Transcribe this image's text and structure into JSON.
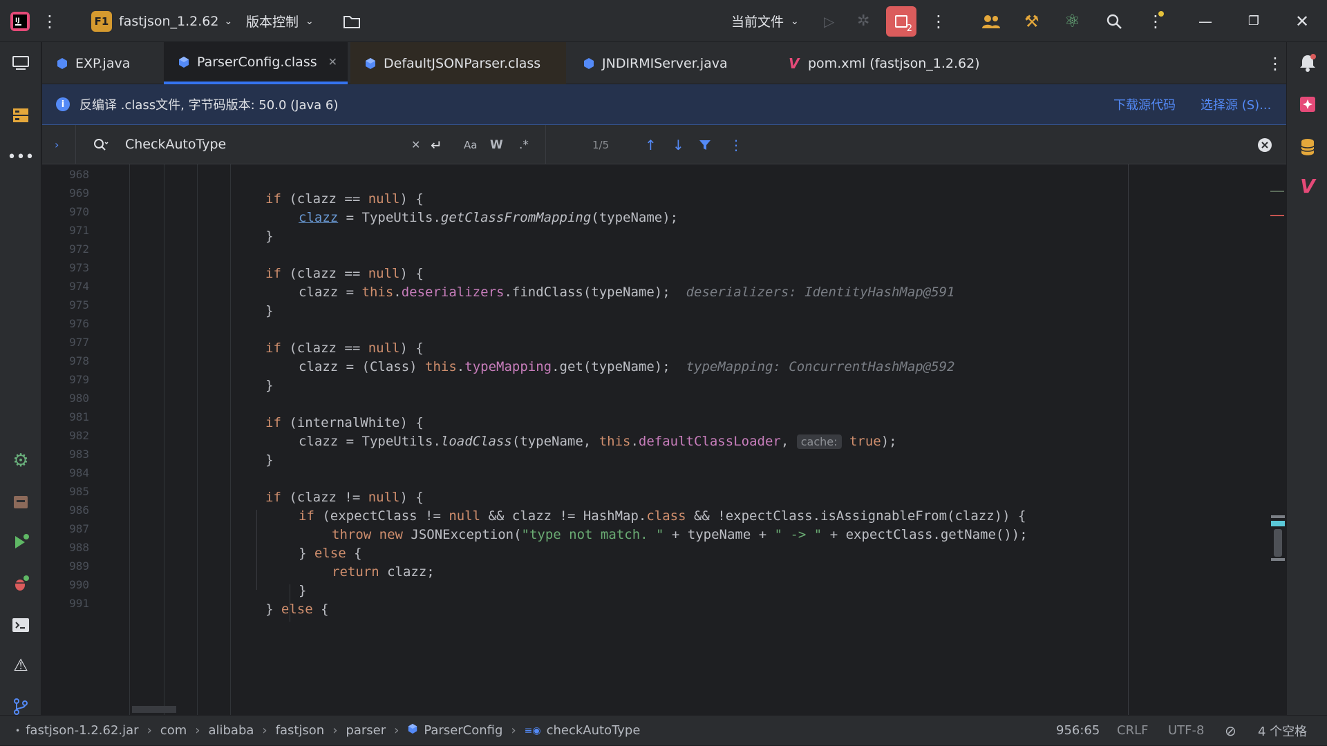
{
  "titlebar": {
    "project_badge": "F1",
    "project_name": "fastjson_1.2.62",
    "vcs_label": "版本控制",
    "run_config": "当前文件",
    "stop_count": "2"
  },
  "tabs": [
    {
      "label": "EXP.java",
      "icon": "java-class-icon"
    },
    {
      "label": "ParserConfig.class",
      "icon": "class-file-icon",
      "active": true
    },
    {
      "label": "DefaultJSONParser.class",
      "icon": "class-file-icon"
    },
    {
      "label": "JNDIRMIServer.java",
      "icon": "java-class-icon"
    },
    {
      "label": "pom.xml (fastjson_1.2.62)",
      "icon": "maven-icon"
    }
  ],
  "banner": {
    "message": "反编译 .class文件, 字节码版本: 50.0 (Java 6)",
    "download_link": "下载源代码",
    "choose_link": "选择源 (S)..."
  },
  "search": {
    "query": "CheckAutoType",
    "match_case_label": "Aa",
    "words_label": "W",
    "regex_label": ".*",
    "result_count": "1/5"
  },
  "editor": {
    "line_numbers": [
      "968",
      "969",
      "970",
      "971",
      "972",
      "973",
      "974",
      "975",
      "976",
      "977",
      "978",
      "979",
      "980",
      "981",
      "982",
      "983",
      "984",
      "985",
      "986",
      "987",
      "988",
      "989",
      "990",
      "991"
    ],
    "hints": {
      "deserializers": "deserializers: IdentityHashMap@591",
      "typeMapping": "typeMapping: ConcurrentHashMap@592",
      "cache_label": "cache:"
    }
  },
  "statusbar": {
    "breadcrumbs": [
      "fastjson-1.2.62.jar",
      "com",
      "alibaba",
      "fastjson",
      "parser",
      "ParserConfig",
      "checkAutoType"
    ],
    "position": "956:65",
    "line_sep": "CRLF",
    "encoding": "UTF-8",
    "indent": "4 个空格"
  }
}
